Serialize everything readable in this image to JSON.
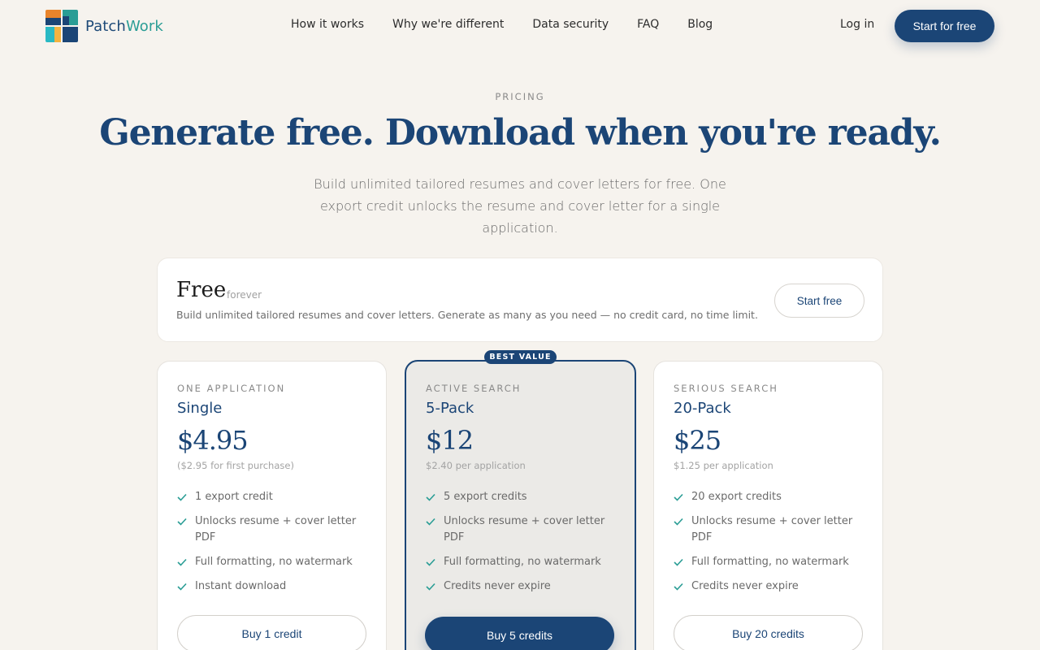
{
  "brand": {
    "name_part1": "Patch",
    "name_part2": "Work",
    "colors": {
      "navy": "#1b4576",
      "teal": "#2a9d95",
      "orange": "#e8842c",
      "yellow": "#f3b340",
      "cyan": "#29b9c4"
    }
  },
  "nav": {
    "links": [
      "How it works",
      "Why we're different",
      "Data security",
      "FAQ",
      "Blog"
    ],
    "login": "Log in",
    "cta": "Start for free"
  },
  "hero": {
    "eyebrow": "PRICING",
    "title": "Generate free. Download when you're ready.",
    "subtitle": "Build unlimited tailored resumes and cover letters for free. One export credit unlocks the resume and cover letter for a single application."
  },
  "free_plan": {
    "title": "Free",
    "subtitle": "forever",
    "description": "Build unlimited tailored resumes and cover letters. Generate as many as you need — no credit card, no time limit.",
    "button": "Start free"
  },
  "plans": [
    {
      "tier": "ONE APPLICATION",
      "name": "Single",
      "price": "$4.95",
      "note": "($2.95 for first purchase)",
      "features": [
        "1 export credit",
        "Unlocks resume + cover letter PDF",
        "Full formatting, no watermark",
        "Instant download"
      ],
      "button": "Buy 1 credit"
    },
    {
      "tier": "ACTIVE SEARCH",
      "name": "5-Pack",
      "price": "$12",
      "note": "$2.40 per application",
      "features": [
        "5 export credits",
        "Unlocks resume + cover letter PDF",
        "Full formatting, no watermark",
        "Credits never expire"
      ],
      "button": "Buy 5 credits",
      "badge": "BEST VALUE"
    },
    {
      "tier": "SERIOUS SEARCH",
      "name": "20-Pack",
      "price": "$25",
      "note": "$1.25 per application",
      "features": [
        "20 export credits",
        "Unlocks resume + cover letter PDF",
        "Full formatting, no watermark",
        "Credits never expire"
      ],
      "button": "Buy 20 credits"
    }
  ]
}
